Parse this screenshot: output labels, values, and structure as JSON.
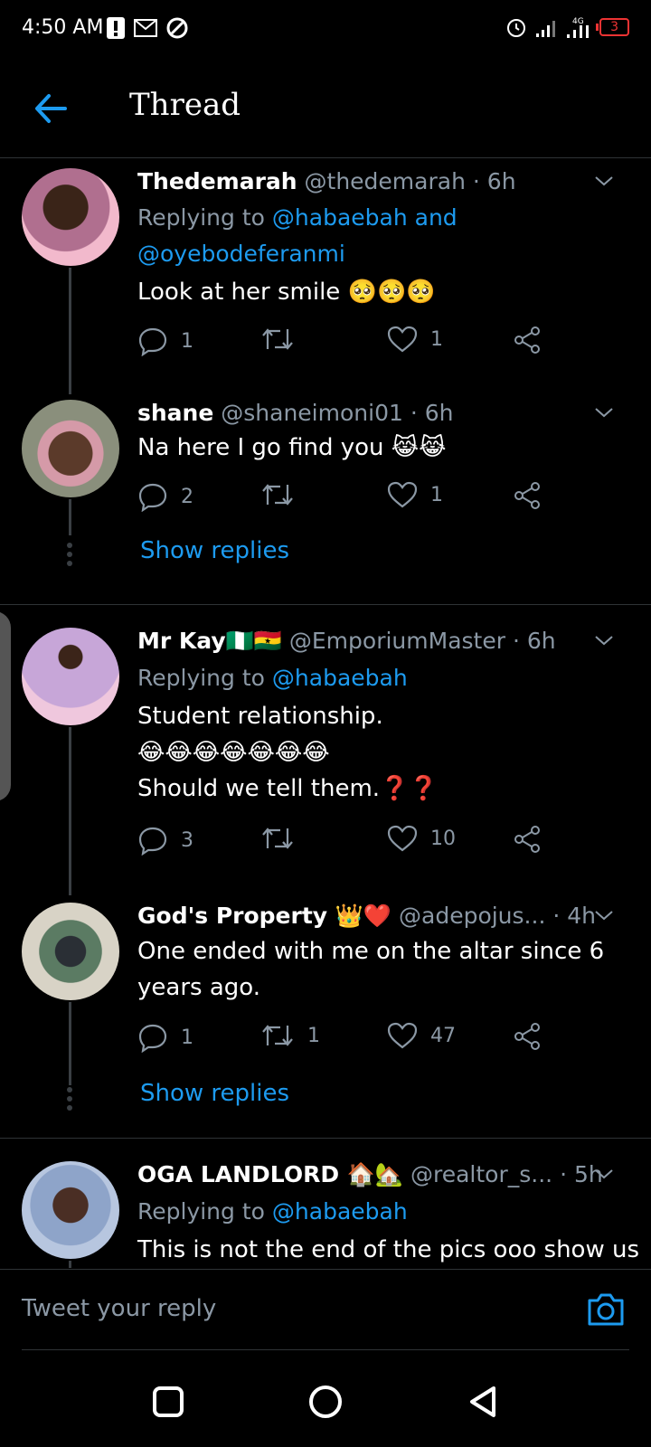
{
  "status_bar": {
    "time": "4:50 AM",
    "network": "4G",
    "battery": "3",
    "icons_left": [
      "alert-icon",
      "mail-icon",
      "app-icon"
    ],
    "icons_right": [
      "alarm-icon",
      "signal-icon",
      "signal-4g-icon",
      "battery-icon"
    ]
  },
  "header": {
    "title": "Thread"
  },
  "tweets": [
    {
      "name": "Thedemarah",
      "handle": "@thedemarah",
      "time": "· 6h",
      "replying_prefix": "Replying to",
      "mentions": [
        "@habaebah and",
        "@oyebodeferanmi"
      ],
      "text": "Look at her smile 🥺🥺🥺",
      "replies": "1",
      "retweets": "",
      "likes": "1"
    },
    {
      "name": "shane",
      "handle": "@shaneimoni01",
      "time": "· 6h",
      "text": "Na here I go find you 😹😹",
      "replies": "2",
      "retweets": "",
      "likes": "1",
      "show_replies": "Show replies"
    },
    {
      "name": "Mr Kay🇳🇬🇬🇭",
      "handle": "@EmporiumMaster",
      "time": "· 6h",
      "replying_prefix": "Replying to",
      "mentions": [
        "@habaebah"
      ],
      "text_lines": [
        "Student relationship.",
        "😂😂😂😂😂😂😂",
        "Should we tell them.❓❓"
      ],
      "replies": "3",
      "retweets": "",
      "likes": "10"
    },
    {
      "name": "God's Property 👑❤️",
      "handle": "@adepojus...",
      "time": "· 4h",
      "text_lines": [
        "One ended with me on the altar since 6",
        "years ago."
      ],
      "replies": "1",
      "retweets": "1",
      "likes": "47",
      "show_replies": "Show replies"
    },
    {
      "name": "OGA LANDLORD 🏠🏡",
      "handle": "@realtor_s...",
      "time": "· 5h",
      "replying_prefix": "Replying to",
      "mentions": [
        "@habaebah"
      ],
      "text": "This is not the end of the pics ooo show us"
    }
  ],
  "reply_bar": {
    "placeholder": "Tweet your reply"
  },
  "colors": {
    "accent": "#1d9bf0",
    "muted": "#8b98a5",
    "background": "#000000",
    "battery_low": "#e33333"
  }
}
